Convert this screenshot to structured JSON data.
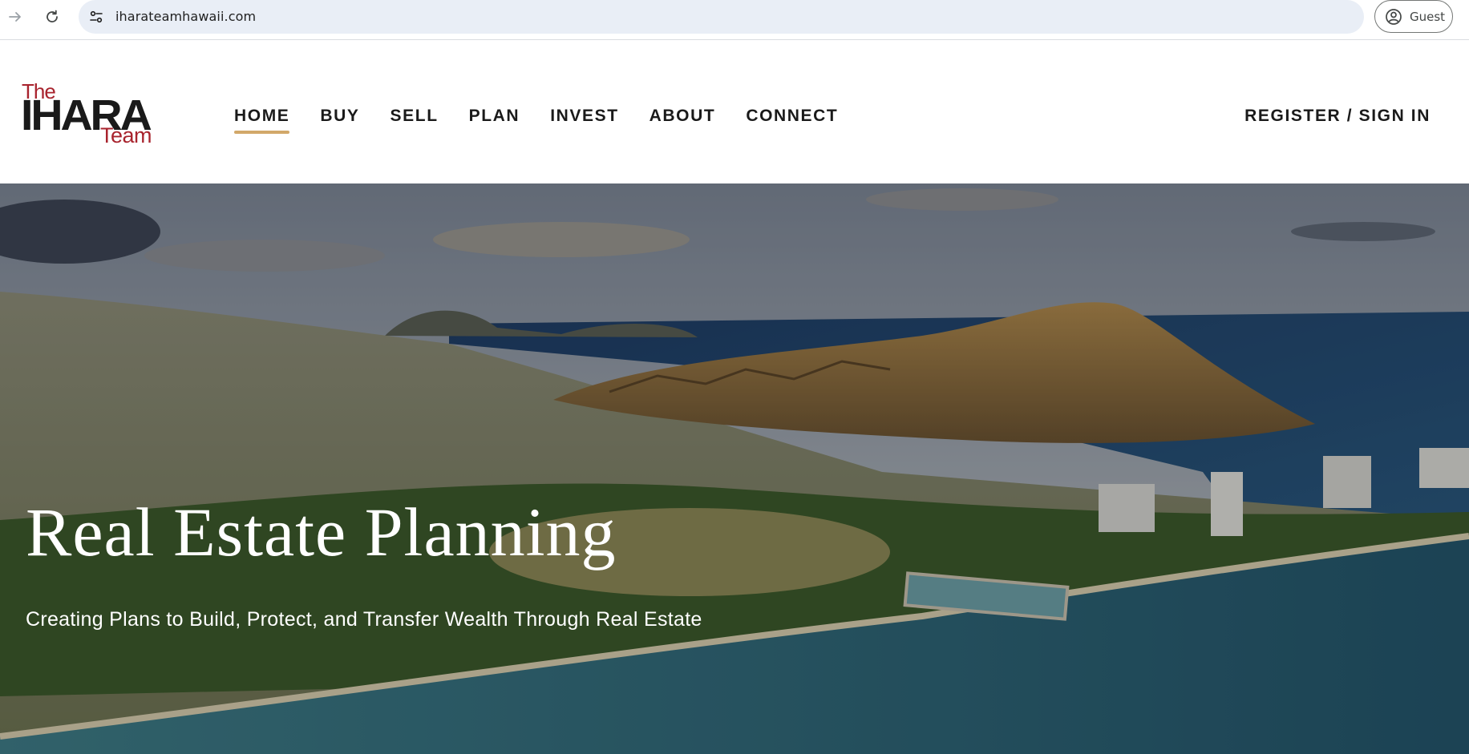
{
  "browser": {
    "url": "iharateamhawaii.com",
    "profile_label": "Guest"
  },
  "logo": {
    "line1": "The",
    "line2": "IHARA",
    "line3": "Team"
  },
  "nav": {
    "items": [
      {
        "label": "HOME",
        "active": true
      },
      {
        "label": "BUY"
      },
      {
        "label": "SELL"
      },
      {
        "label": "PLAN"
      },
      {
        "label": "INVEST"
      },
      {
        "label": "ABOUT"
      },
      {
        "label": "CONNECT"
      }
    ],
    "register_label": "REGISTER / SIGN IN",
    "active_color": "#d2a86a"
  },
  "hero": {
    "title": "Real Estate Planning",
    "subtitle": "Creating Plans to Build, Protect, and Transfer Wealth Through Real Estate"
  },
  "colors": {
    "brand_red": "#a8232d",
    "text_dark": "#1a1a1a",
    "accent_gold": "#d2a86a"
  }
}
